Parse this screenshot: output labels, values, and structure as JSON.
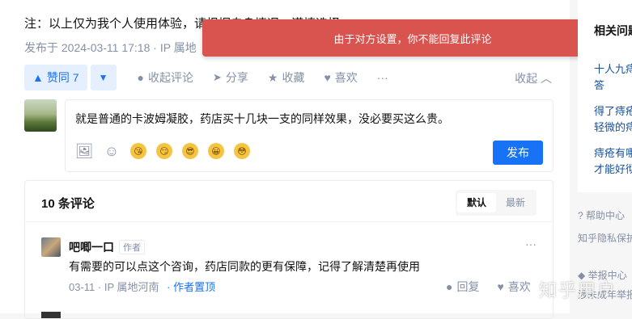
{
  "answer": {
    "note": "注：以上仅为我个人使用体验，请根据自身情况，谨慎选择",
    "published": "发布于 2024-03-11 17:18 · IP 属地",
    "vote_up": "赞同 7",
    "collapse_comments": "收起评论",
    "share": "分享",
    "favorite": "收藏",
    "like": "喜欢",
    "more": "···",
    "collapse": "收起"
  },
  "toast": {
    "message": "由于对方设置，你不能回复此评论"
  },
  "editor": {
    "text": "就是普通的卡波姆凝胶，药店买十几块一支的同样效果，没必要买这么贵。",
    "publish": "发布",
    "emojis": [
      "😘",
      "😏",
      "😎",
      "😀",
      "😳"
    ]
  },
  "comments": {
    "count": "10 条评论",
    "sort_default": "默认",
    "sort_latest": "最新",
    "items": [
      {
        "user": "吧唧一口",
        "badge": "作者",
        "text": "有需要的可以点这个咨询，药店同款的更有保障，记得了解清楚再使用",
        "date": "03-11",
        "location": "IP 属地河南",
        "pinned": "· 作者置顶",
        "reply": "回复",
        "like": "喜欢",
        "more": "···"
      }
    ]
  },
  "sidebar": {
    "head": "相关问题",
    "links": [
      "十人九痔",
      "答",
      "得了痔疮",
      "轻微的痔",
      "痔疮有哪",
      "才能好彻"
    ],
    "help": "帮助中心",
    "privacy": "知乎隐私保护",
    "report": "举报中心",
    "report_sub": "涉未成年举报"
  },
  "watermark": "知乎用户",
  "colors": {
    "accent": "#1772f6",
    "toast": "#d9534f",
    "muted": "#8590a6"
  }
}
